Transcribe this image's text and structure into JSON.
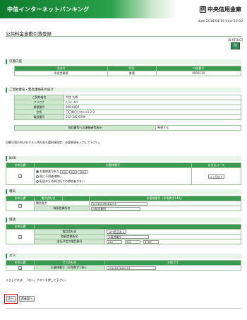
{
  "header": {
    "brand": "中信インターネットバンキング",
    "bank_mark": "信",
    "bank_name": "中央信用金庫"
  },
  "date": "date 2014/04/16 time 13:00",
  "page_title": "公共料金自動引落登録",
  "page_code": "[B-KT-003]",
  "print_label": "印",
  "account": {
    "section": "引落口座",
    "headers": [
      "支店名",
      "科目",
      "口座番号"
    ],
    "row": [
      "本店営業部",
      "普通",
      "0000110"
    ]
  },
  "contractor": {
    "section": "ご契約者名・緊急連絡先の届け",
    "rows": [
      {
        "label": "ご契約者名",
        "value": "中信 太郎"
      },
      {
        "label": "フリガナ",
        "value": "ﾁｭｳｼﾝ ﾀﾛｳ"
      },
      {
        "label": "郵便番号",
        "value": "000-0000"
      },
      {
        "label": "住所",
        "value": "〇〇県〇〇市××1-2-3"
      },
      {
        "label": "電話番号",
        "value": "012-345-6789"
      }
    ],
    "notify_label": "領収書等への連帳者等表示",
    "notify_value": "希望する"
  },
  "instruction": "自動引落の申込をする公共料金を選択後指定、必要事項を入力して下さい。",
  "nhk": {
    "section": "NHK",
    "headers": [
      "お申込欄",
      "お客様番号",
      "お支払コース"
    ],
    "radio_options": [
      "お客様番号有り",
      "既に不明者様無い",
      "転居のため新住所での締結者がない"
    ],
    "code_parts": [
      "100",
      "200",
      "3000"
    ],
    "course": "2ヶ月払"
  },
  "electric": {
    "section": "電気",
    "headers": [
      "お申込欄",
      "電力会社名",
      "お客様番号（半角数字14桁）"
    ],
    "company": "関西電力",
    "customer_no": "12345678901234",
    "office_label": "取扱営業所名",
    "office": "大阪営業所"
  },
  "phone": {
    "section": "電話",
    "headers": [
      "お申込欄"
    ],
    "rows": [
      {
        "label": "電話会社名",
        "value": "NTT西日本"
      },
      {
        "label": "取扱営業所名",
        "value": "大阪営業所"
      },
      {
        "label": "支払予定の電話番号",
        "value": ""
      }
    ],
    "tel": [
      "012",
      "345",
      "6789"
    ]
  },
  "gas": {
    "section": "ガス",
    "headers": [
      "お申込欄",
      "ガス会社名"
    ],
    "company": "大阪ガス",
    "no_label": "お客様番号（半角数字13桁）",
    "customer_no": "1234567890123"
  },
  "confirm_text": "よろしければ、「次へ」ボタンを押して下さい。",
  "buttons": {
    "next": "次へ",
    "back": "前画面へ"
  }
}
